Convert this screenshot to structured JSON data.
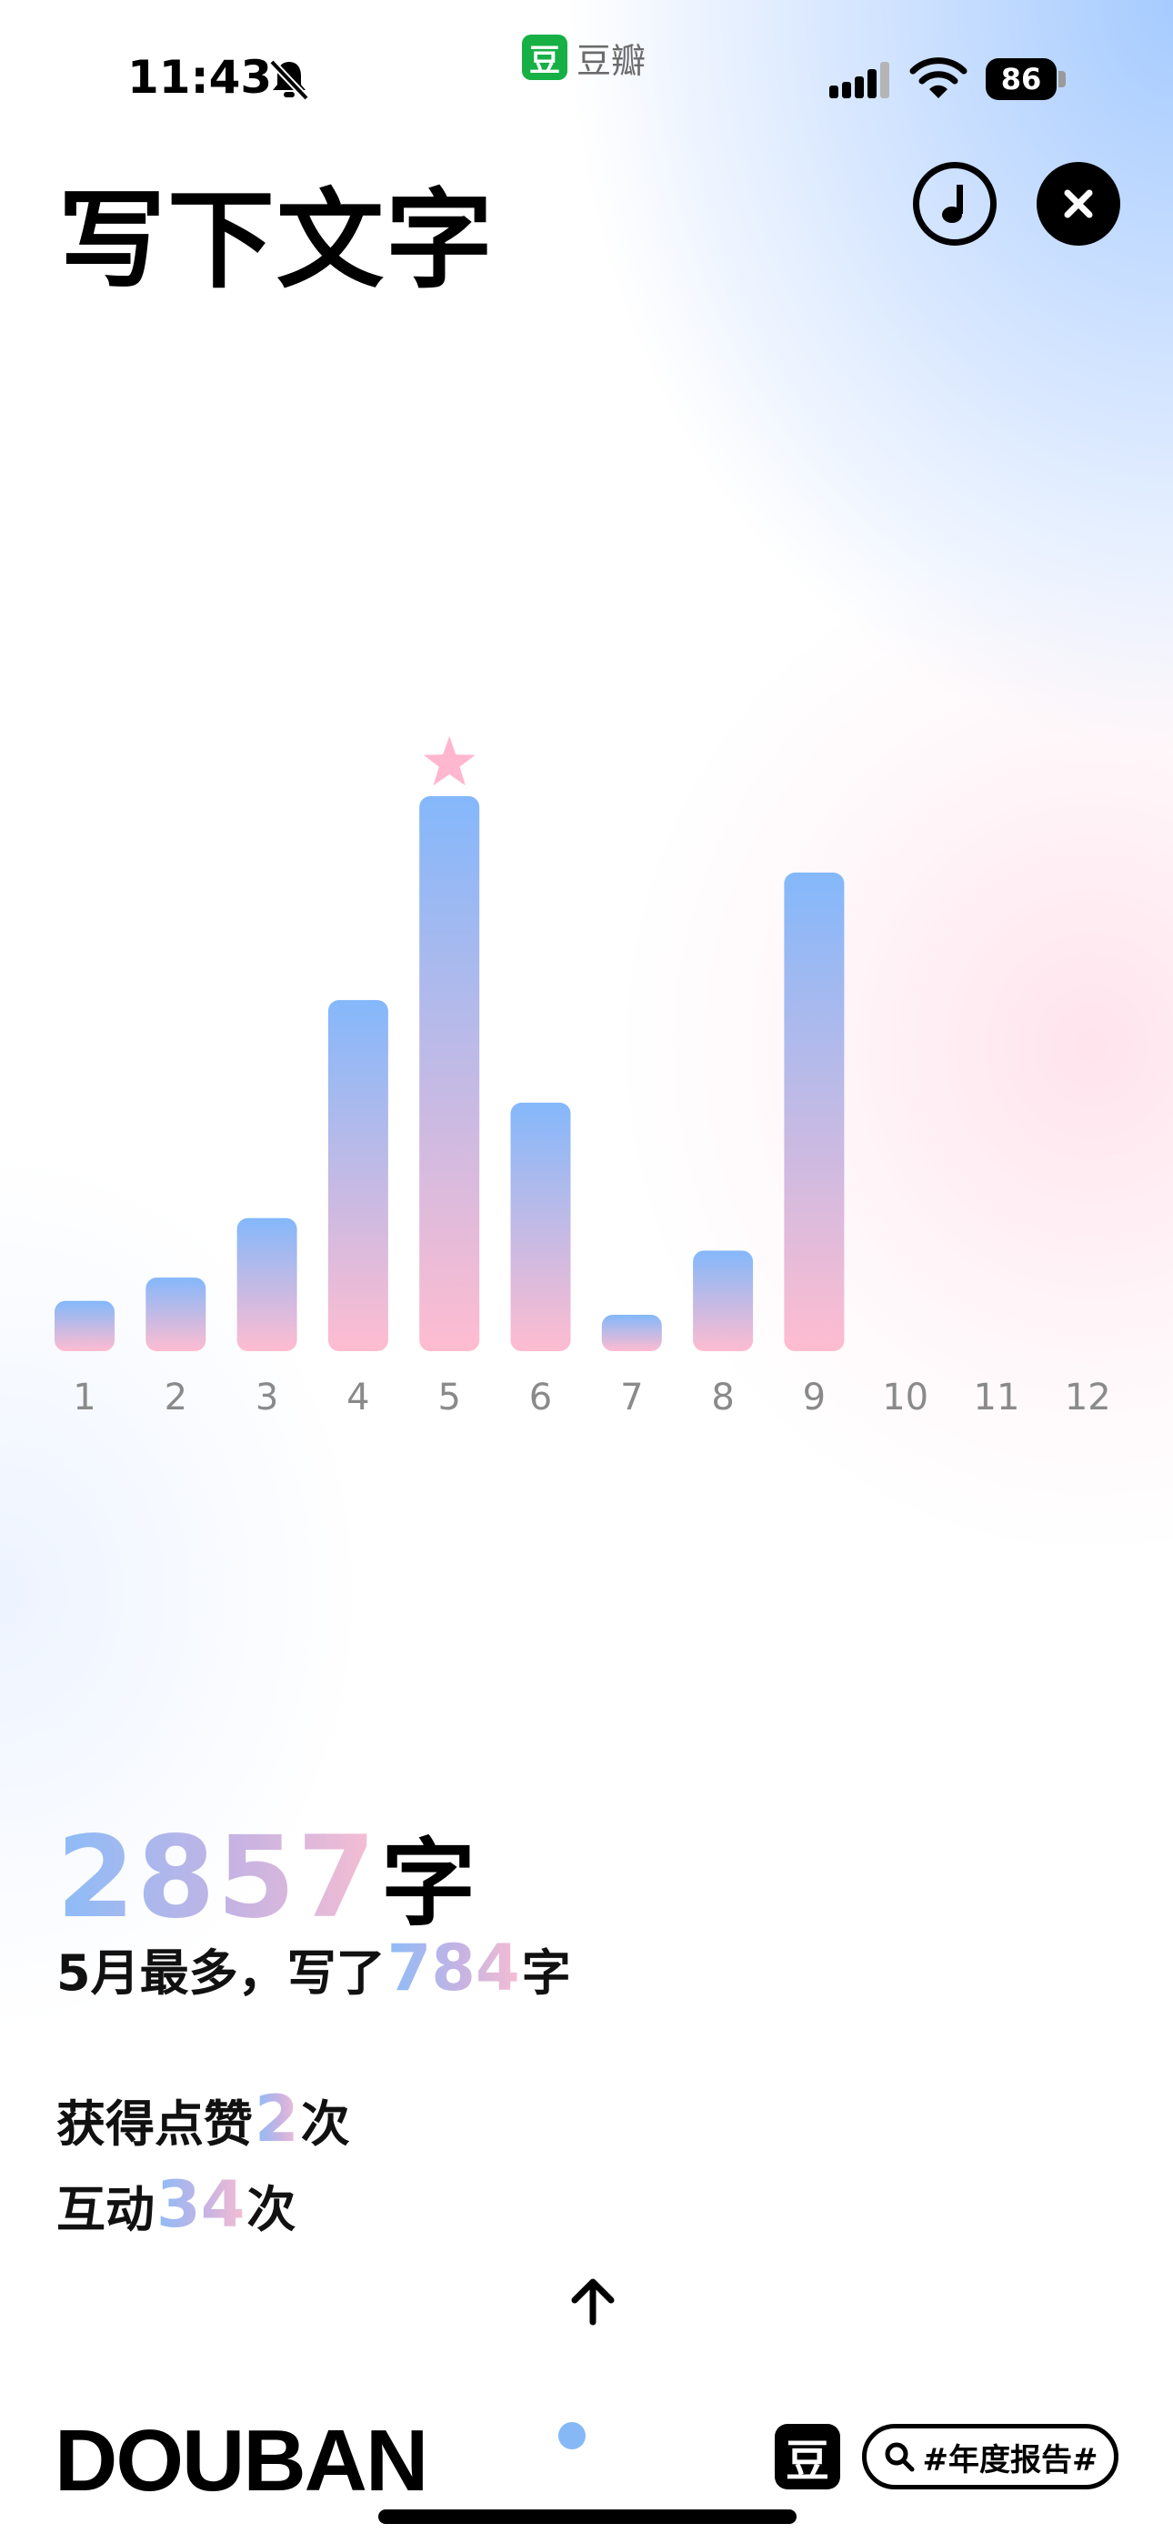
{
  "status_bar": {
    "time": "11:43",
    "battery": "86",
    "app_name": "豆瓣",
    "app_logo_char": "豆"
  },
  "header": {
    "title": "写下文字"
  },
  "chart_data": {
    "type": "bar",
    "categories": [
      "1",
      "2",
      "3",
      "4",
      "5",
      "6",
      "7",
      "8",
      "9",
      "10",
      "11",
      "12"
    ],
    "values": [
      71,
      104,
      188,
      496,
      784,
      351,
      42,
      142,
      676,
      0,
      0,
      0
    ],
    "highlight_index": 4,
    "ylim": [
      0,
      784
    ],
    "grid": false,
    "colors": {
      "bar_top": "#84b8fb",
      "bar_bottom": "#ffbcd0",
      "star": "#ffb6cf",
      "tick": "#8a8a8a"
    }
  },
  "stats": {
    "total_value": "2857",
    "total_unit": "字",
    "month_prefix": "5月最多，写了",
    "month_value": "784",
    "month_unit": "字",
    "likes_prefix": "获得点赞",
    "likes_value": "2",
    "likes_unit": "次",
    "interactions_prefix": "互动",
    "interactions_value": "34",
    "interactions_unit": "次"
  },
  "footer": {
    "brand": "DOUBAN",
    "logo_char": "豆",
    "hashtag": "#年度报告#"
  }
}
